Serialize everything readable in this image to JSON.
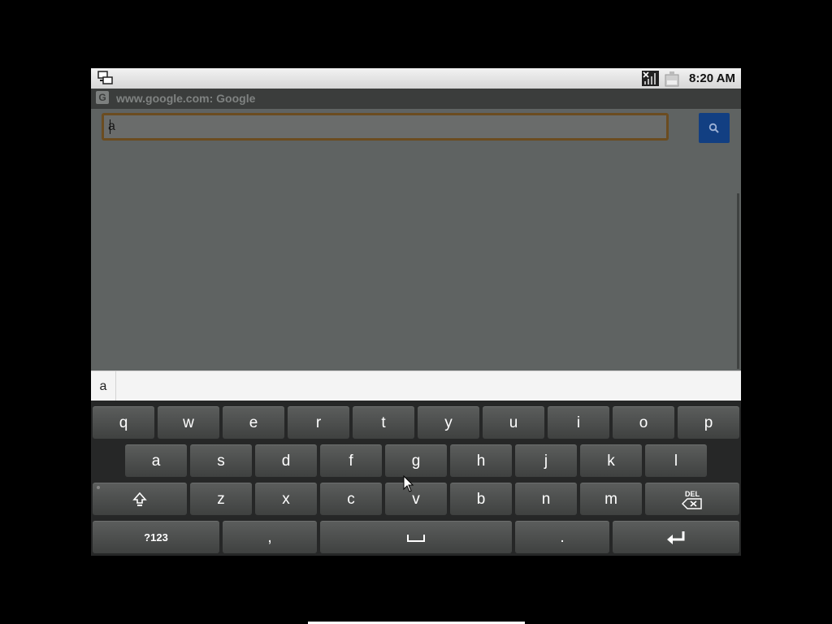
{
  "status_bar": {
    "time": "8:20 AM",
    "icons": [
      "network-connected-icon",
      "signal-no-service-icon",
      "battery-charging-icon"
    ]
  },
  "title_bar": {
    "favicon_letter": "G",
    "title": "www.google.com: Google"
  },
  "search": {
    "value": "a",
    "button_icon": "magnifier-icon"
  },
  "suggestions": {
    "items": [
      "a"
    ]
  },
  "keyboard": {
    "row1": [
      "q",
      "w",
      "e",
      "r",
      "t",
      "y",
      "u",
      "i",
      "o",
      "p"
    ],
    "row2": [
      "a",
      "s",
      "d",
      "f",
      "g",
      "h",
      "j",
      "k",
      "l"
    ],
    "row3": [
      "z",
      "x",
      "c",
      "v",
      "b",
      "n",
      "m"
    ],
    "shift_icon": "shift-icon",
    "del_label": "DEL",
    "symbols_label": "?123",
    "comma": ",",
    "period": ".",
    "space_icon": "space-icon",
    "enter_icon": "enter-icon"
  },
  "colors": {
    "search_button": "#123f82",
    "input_border": "#6b4c20",
    "page_background": "#5f6362"
  }
}
